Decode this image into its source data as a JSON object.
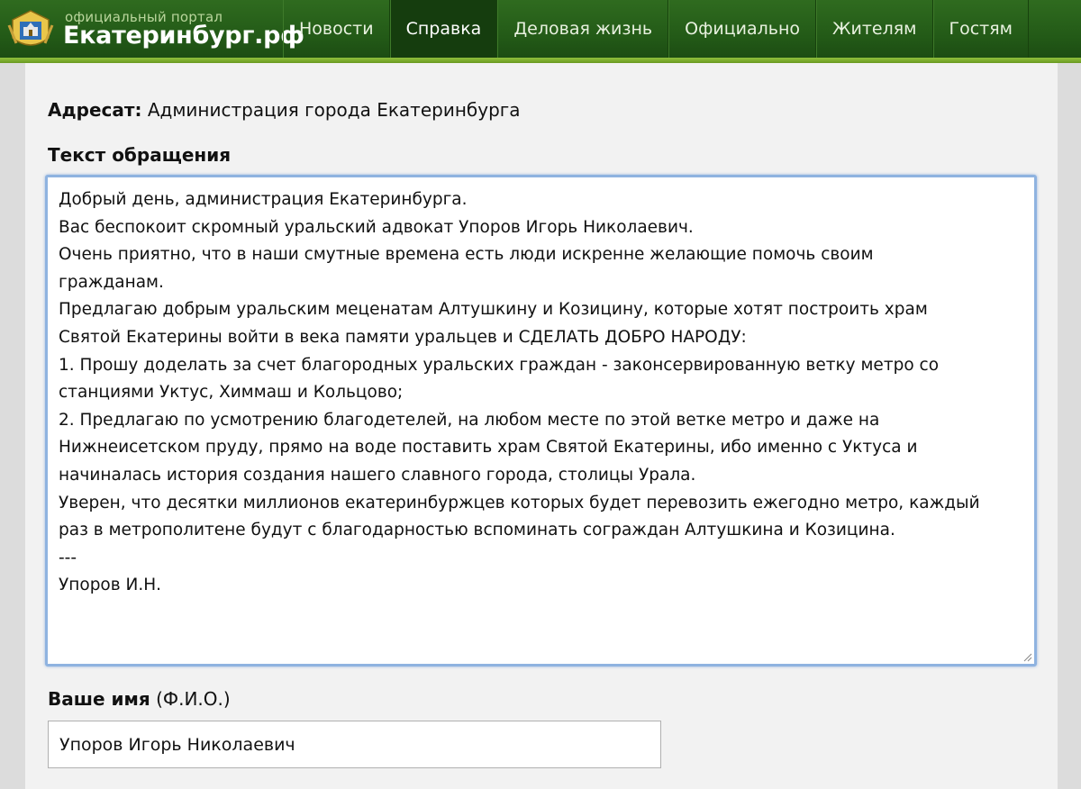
{
  "header": {
    "logo_small": "официальный портал",
    "logo_big": "Екатеринбург.рф",
    "nav": [
      {
        "label": "Новости",
        "active": false
      },
      {
        "label": "Справка",
        "active": true
      },
      {
        "label": "Деловая жизнь",
        "active": false
      },
      {
        "label": "Официально",
        "active": false
      },
      {
        "label": "Жителям",
        "active": false
      },
      {
        "label": "Гостям",
        "active": false
      }
    ]
  },
  "form": {
    "addressee_label": "Адресат:",
    "addressee_value": "Администрация города Екатеринбурга",
    "text_label": "Текст обращения",
    "text_value": "Добрый день, администрация Екатеринбурга.\nВас беспокоит скромный уральский адвокат Упоров Игорь Николаевич.\nОчень приятно, что в наши смутные времена есть люди искренне желающие помочь своим\nгражданам.\nПредлагаю добрым уральским меценатам Алтушкину и Козицину, которые хотят построить храм\nСвятой Екатерины войти в века памяти уральцев и СДЕЛАТЬ ДОБРО НАРОДУ:\n1. Прошу доделать за счет благородных уральских граждан - законсервированную ветку метро со\nстанциями Уктус, Химмаш и Кольцово;\n2. Предлагаю по усмотрению благодетелей, на любом месте по этой ветке метро и даже на\nНижнеисетском пруду, прямо на воде поставить храм Святой Екатерины, ибо именно с Уктуса и\nначиналась история создания нашего славного города, столицы Урала.\nУверен, что десятки миллионов екатеринбуржцев которых будет перевозить ежегодно метро, каждый\nраз в метрополитене будут с благодарностью вспоминать сограждан Алтушкина и Козицина.\n---\nУпоров И.Н.",
    "name_label_bold": "Ваше имя",
    "name_label_hint": "(Ф.И.О.)",
    "name_value": "Упоров Игорь Николаевич"
  },
  "colors": {
    "header_green": "#235a17",
    "active_tab": "#153d0e",
    "focus_border": "#8fb3e0"
  }
}
